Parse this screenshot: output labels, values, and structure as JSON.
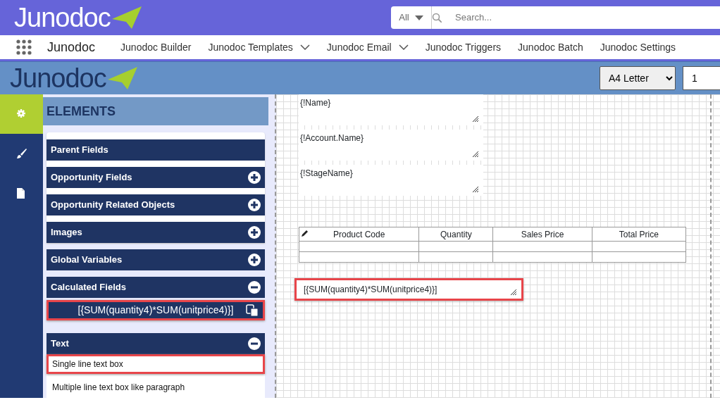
{
  "top_bar": {
    "logo": "Junodoc",
    "search": {
      "scope": "All",
      "placeholder": "Search..."
    }
  },
  "nav": {
    "app_name": "Junodoc",
    "items": [
      {
        "label": "Junodoc Builder",
        "has_menu": false
      },
      {
        "label": "Junodoc Templates",
        "has_menu": true
      },
      {
        "label": "Junodoc Email",
        "has_menu": true
      },
      {
        "label": "Junodoc Triggers",
        "has_menu": false
      },
      {
        "label": "Junodoc Batch",
        "has_menu": false
      },
      {
        "label": "Junodoc Settings",
        "has_menu": false
      }
    ]
  },
  "builder_bar": {
    "logo": "Junodoc",
    "page_size": "A4 Letter",
    "page_number": "1"
  },
  "rail": [
    {
      "kind": "gear",
      "selected": true
    },
    {
      "kind": "brush",
      "selected": false
    },
    {
      "kind": "file",
      "selected": false
    }
  ],
  "elements": {
    "title": "ELEMENTS",
    "sections": [
      {
        "label": "Parent Fields",
        "kind": "plain"
      },
      {
        "label": "Opportunity Fields",
        "kind": "toggle",
        "expanded": false
      },
      {
        "label": "Opportunity Related Objects",
        "kind": "toggle",
        "expanded": false
      },
      {
        "label": "Images",
        "kind": "toggle",
        "expanded": false
      },
      {
        "label": "Global Variables",
        "kind": "toggle",
        "expanded": false
      },
      {
        "label": "Calculated Fields",
        "kind": "toggle",
        "expanded": true,
        "items": [
          {
            "kind": "formula",
            "text": "[{SUM(quantity4)*SUM(unitprice4)}]",
            "highlighted": true
          }
        ]
      },
      {
        "label": "Text",
        "kind": "toggle",
        "expanded": true,
        "items": [
          {
            "kind": "text",
            "text": "Single line text box",
            "highlighted": true
          },
          {
            "kind": "text",
            "text": "Multiple line text box like paragraph",
            "highlighted": false
          }
        ]
      }
    ]
  },
  "canvas": {
    "fields": [
      {
        "text": "{!Name}"
      },
      {
        "text": "{!Account.Name}"
      },
      {
        "text": "{!StageName}"
      }
    ],
    "table": {
      "columns": [
        "Product Code",
        "Quantity",
        "Sales Price",
        "Total Price"
      ],
      "rows": [
        {
          "kind": "empty"
        },
        {
          "kind": "empty"
        }
      ]
    },
    "calc_field": {
      "text": "[{SUM(quantity4)*SUM(unitprice4)}]",
      "highlighted": true
    }
  }
}
